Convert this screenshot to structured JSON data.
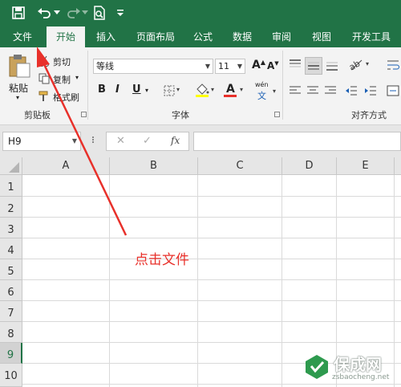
{
  "tabs": [
    "文件",
    "开始",
    "插入",
    "页面布局",
    "公式",
    "数据",
    "审阅",
    "视图",
    "开发工具"
  ],
  "clipboard": {
    "paste": "粘贴",
    "cut": "剪切",
    "copy": "复制",
    "format_painter": "格式刷",
    "group": "剪贴板"
  },
  "font": {
    "name": "等线",
    "size": "11",
    "grow": "A",
    "shrink": "A",
    "bold": "B",
    "italic": "I",
    "underline": "U",
    "font_color": "A",
    "phonetic_top": "wén",
    "phonetic_bottom": "文",
    "group": "字体"
  },
  "alignment": {
    "group": "对齐方式"
  },
  "formula_bar": {
    "name_box": "H9",
    "fx": "fx",
    "cancel": "✕",
    "enter": "✓"
  },
  "columns": [
    "A",
    "B",
    "C",
    "D",
    "E"
  ],
  "rows": [
    "1",
    "2",
    "3",
    "4",
    "5",
    "6",
    "7",
    "8",
    "9",
    "10"
  ],
  "selected_row": "9",
  "annotation": "点击文件",
  "watermark": {
    "brand": "保成网",
    "url": "zsbaocheng.net"
  },
  "colors": {
    "excel_green": "#217346",
    "annotation_red": "#e8302a"
  }
}
